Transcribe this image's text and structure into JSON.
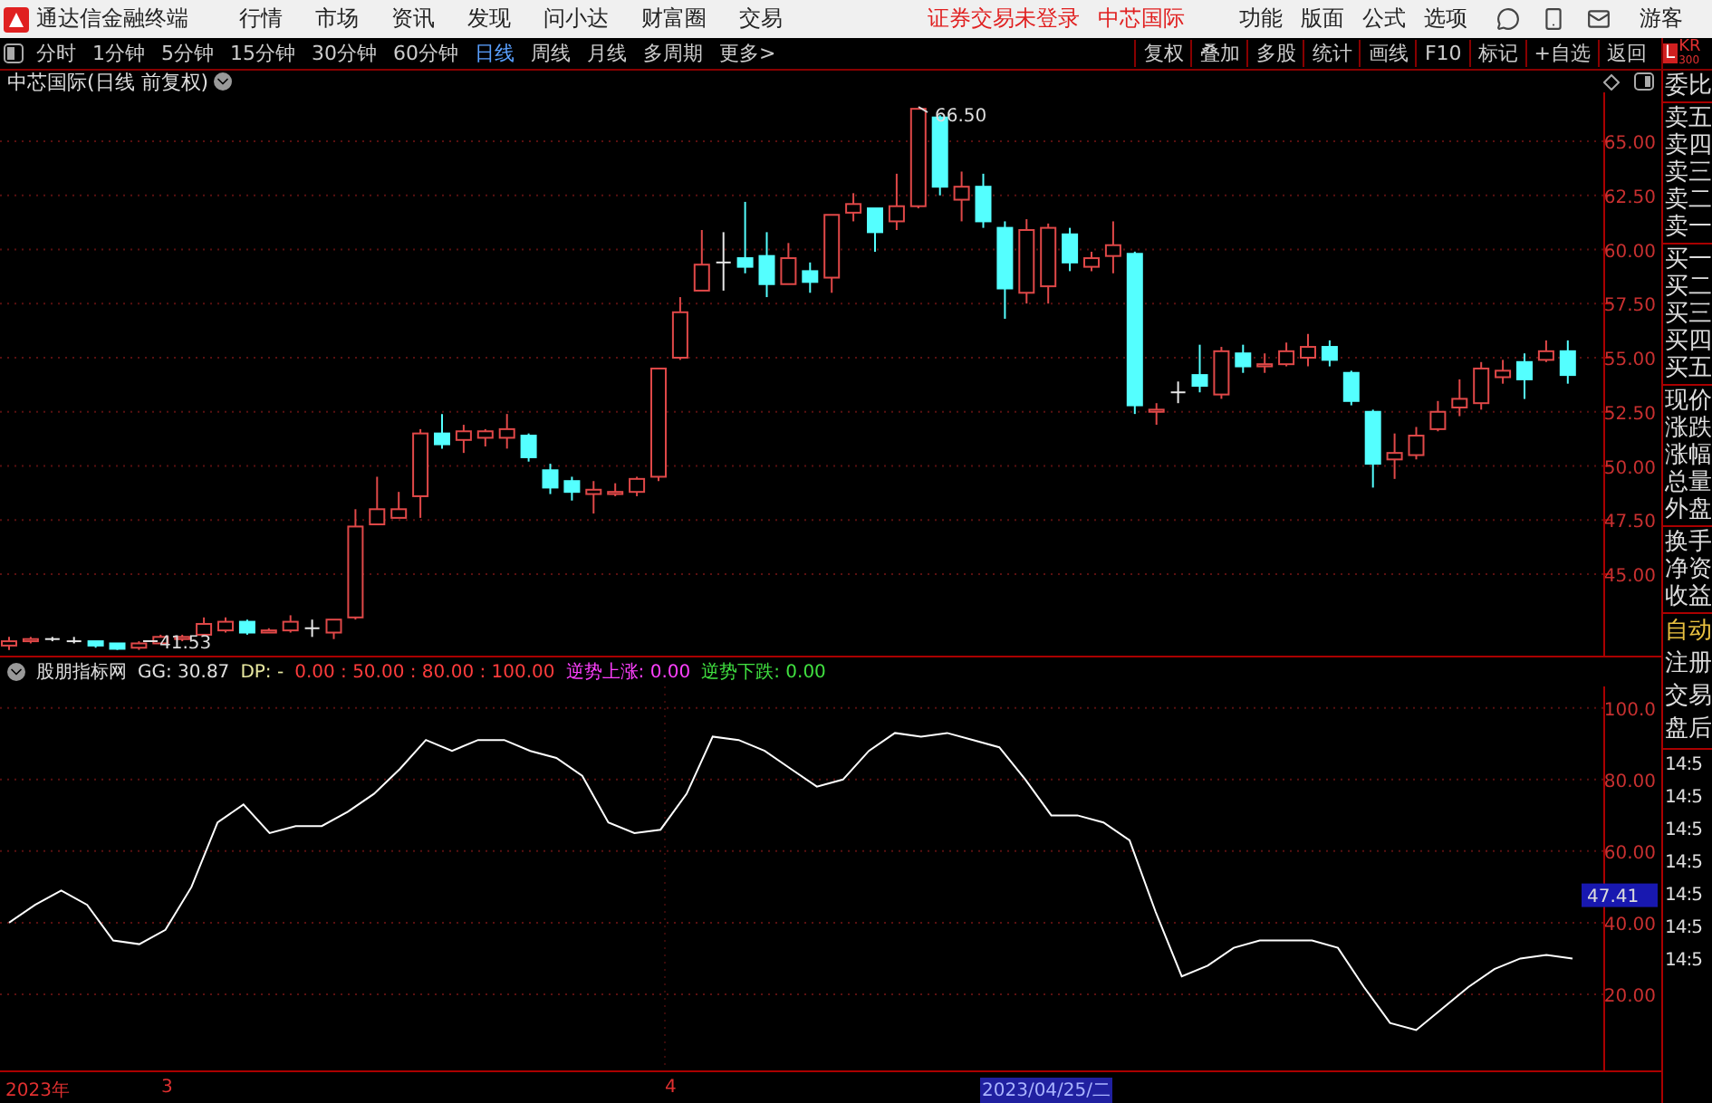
{
  "menubar": {
    "app_title": "通达信金融终端",
    "menu": [
      "行情",
      "市场",
      "资讯",
      "发现",
      "问小达",
      "财富圈",
      "交易"
    ],
    "notices": [
      "证券交易未登录",
      "中芯国际"
    ],
    "tools": [
      "功能",
      "版面",
      "公式",
      "选项"
    ],
    "user": "游客"
  },
  "toolbar": {
    "periods": [
      {
        "label": "分时",
        "selected": false
      },
      {
        "label": "1分钟",
        "selected": false
      },
      {
        "label": "5分钟",
        "selected": false
      },
      {
        "label": "15分钟",
        "selected": false
      },
      {
        "label": "30分钟",
        "selected": false
      },
      {
        "label": "60分钟",
        "selected": false
      },
      {
        "label": "日线",
        "selected": true
      },
      {
        "label": "周线",
        "selected": false
      },
      {
        "label": "月线",
        "selected": false
      },
      {
        "label": "多周期",
        "selected": false
      },
      {
        "label": "更多>",
        "selected": false
      }
    ],
    "actions": [
      "复权",
      "叠加",
      "多股",
      "统计",
      "画线",
      "F10",
      "标记",
      "+自选",
      "返回"
    ],
    "badge": {
      "letter": "L",
      "code": "KR",
      "sub": "300"
    }
  },
  "main_chart": {
    "title": "中芯国际(日线 前复权)",
    "price_axis": [
      "65.00",
      "62.50",
      "60.00",
      "57.50",
      "55.00",
      "52.50",
      "50.00",
      "47.50",
      "45.00"
    ],
    "high_label": "66.50",
    "low_label": "41.53"
  },
  "indicator": {
    "legend": [
      {
        "text": "股朋指标网",
        "color": "#e0e0e0"
      },
      {
        "text": "GG: 30.87",
        "color": "#e0e0e0"
      },
      {
        "text": "DP: -",
        "color": "#e8e8a0"
      },
      {
        "text": "0.00 : 50.00 : 80.00 : 100.00",
        "color": "#ff3c3c"
      },
      {
        "text": "逆势上涨: 0.00",
        "color": "#ff40ff"
      },
      {
        "text": "逆势下跌: 0.00",
        "color": "#40e040"
      }
    ],
    "cursor_value": "47.41",
    "chart_data": {
      "type": "line",
      "ylim": [
        0,
        106
      ],
      "yticks": [
        {
          "value": 100,
          "label": "100.0"
        },
        {
          "value": 80,
          "label": "80.00"
        },
        {
          "value": 60,
          "label": "60.00"
        },
        {
          "value": 40,
          "label": "40.00"
        },
        {
          "value": 20,
          "label": "20.00"
        }
      ],
      "grid": true,
      "series": [
        {
          "color": "#ffffff",
          "values": [
            40,
            45,
            49,
            45,
            35,
            34,
            38,
            50,
            68,
            73,
            65,
            67,
            67,
            71,
            76,
            83,
            91,
            88,
            91,
            91,
            88,
            86,
            81,
            68,
            65,
            66,
            76,
            92,
            91,
            88,
            83,
            78,
            80,
            88,
            93,
            92,
            93,
            91,
            89,
            80,
            70,
            70,
            68,
            63,
            43,
            25,
            28,
            33,
            35,
            35,
            35,
            33,
            22,
            12,
            10,
            16,
            22,
            27,
            30,
            31,
            30
          ]
        }
      ]
    }
  },
  "time_axis": [
    {
      "label": "2023年",
      "selected": false
    },
    {
      "label": "3",
      "selected": false
    },
    {
      "label": "4",
      "selected": false
    },
    {
      "label": "2023/04/25/二",
      "selected": true
    }
  ],
  "quote_panel": {
    "groups": [
      [
        "委比"
      ],
      [
        "卖五",
        "卖四",
        "卖三",
        "卖二",
        "卖一"
      ],
      [
        "买一",
        "买二",
        "买三",
        "买四",
        "买五"
      ],
      [
        "现价",
        "涨跌",
        "涨幅",
        "总量",
        "外盘"
      ],
      [
        "换手",
        "净资",
        "收益"
      ]
    ],
    "modes": [
      {
        "label": "自动",
        "active": true
      },
      {
        "label": "注册",
        "active": false
      },
      {
        "label": "交易",
        "active": false
      },
      {
        "label": "盘后",
        "active": false
      }
    ],
    "times": [
      "14:5",
      "14:5",
      "14:5",
      "14:5",
      "14:5",
      "14:5",
      "14:5"
    ]
  }
}
